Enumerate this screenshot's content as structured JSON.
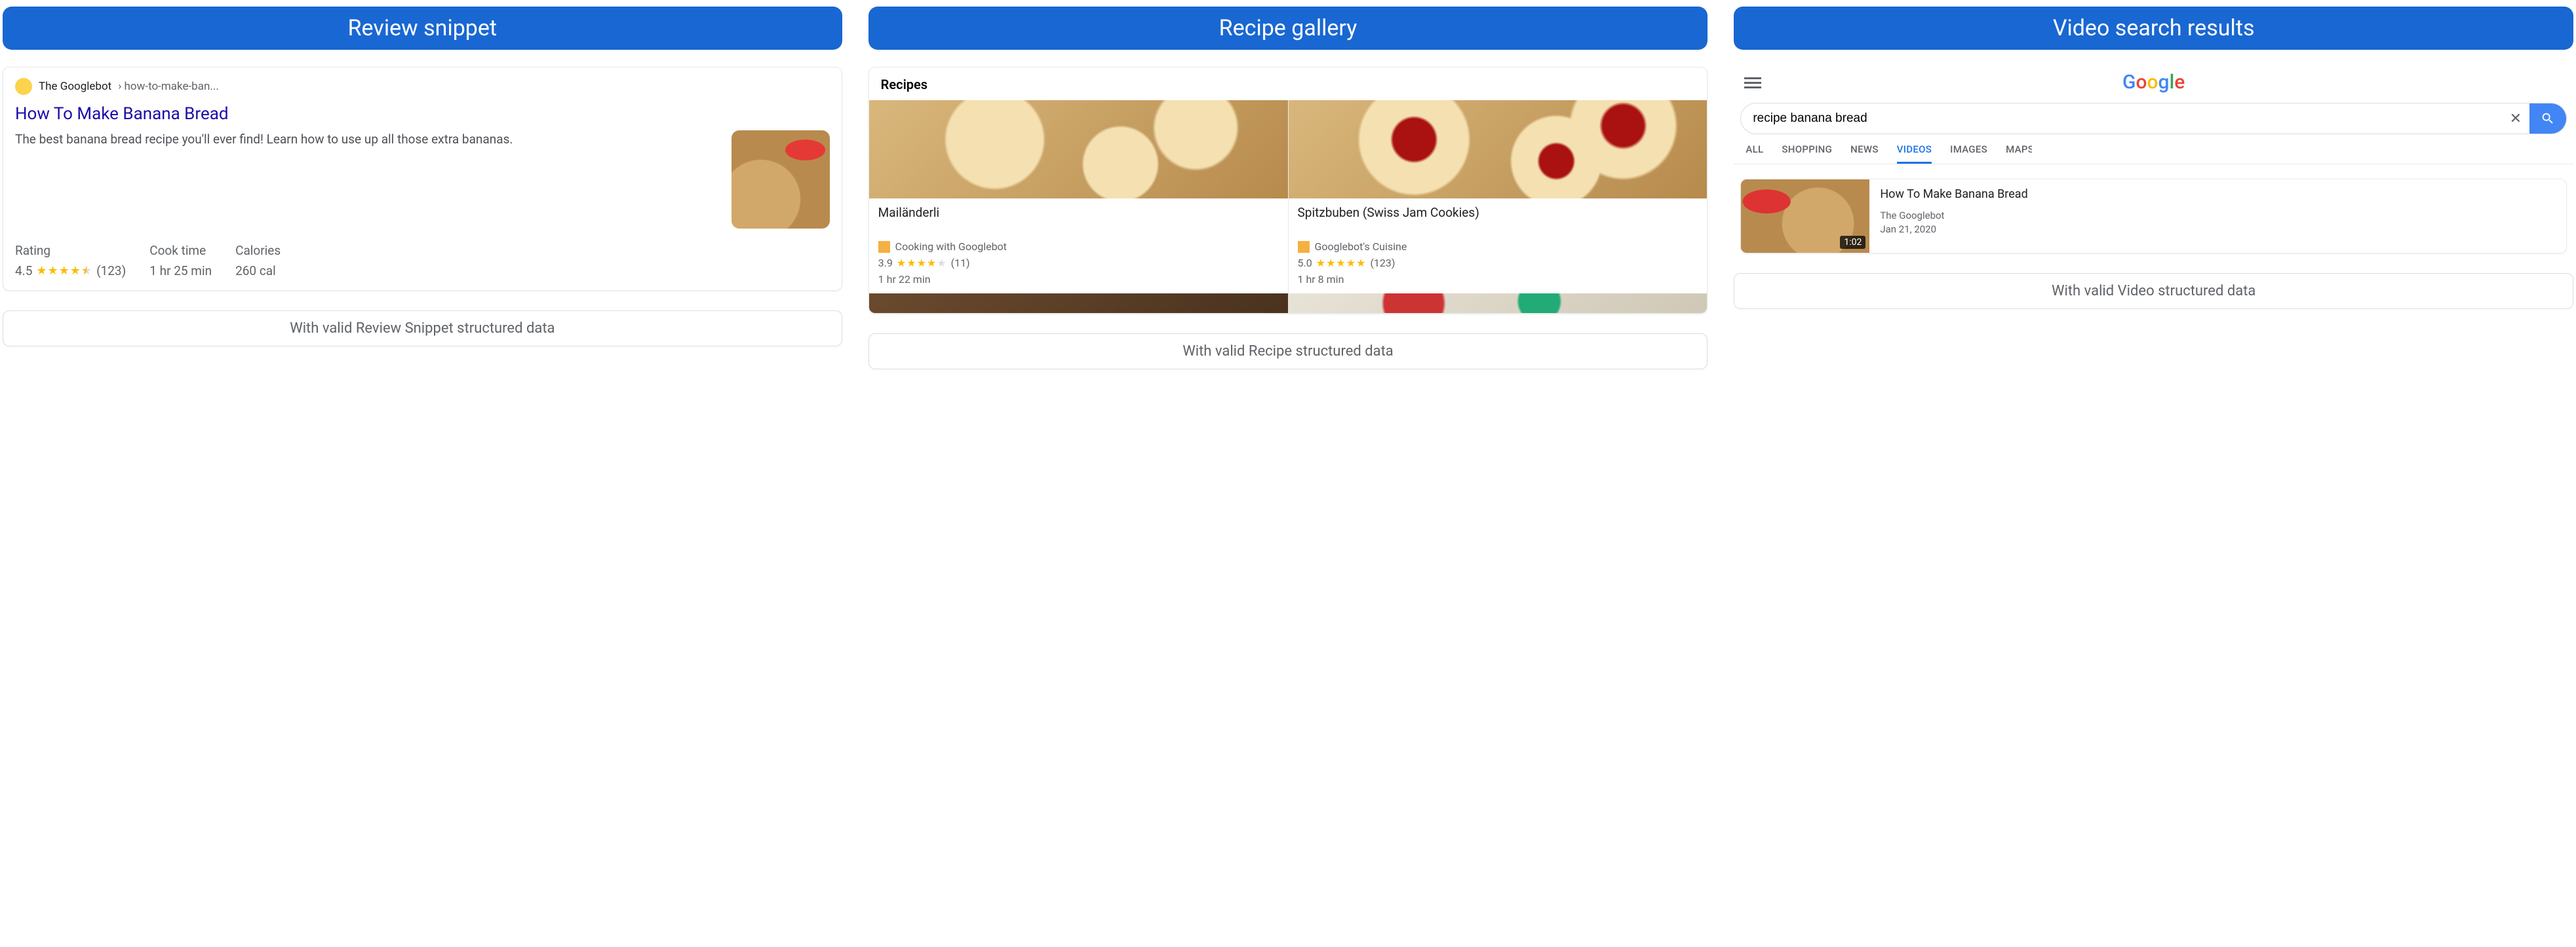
{
  "headers": {
    "review": "Review snippet",
    "gallery": "Recipe gallery",
    "video": "Video search results"
  },
  "captions": {
    "review": "With valid Review Snippet structured data",
    "gallery": "With valid Recipe structured data",
    "video": "With valid Video structured data"
  },
  "review_snippet": {
    "source_name": "The Googlebot",
    "source_path": "› how-to-make-ban...",
    "title": "How To Make Banana Bread",
    "description": "The best banana bread recipe you'll ever find! Learn how to use up all those extra bananas.",
    "rating_label": "Rating",
    "rating_value": "4.5",
    "rating_count": "(123)",
    "cook_label": "Cook time",
    "cook_value": "1 hr 25 min",
    "cal_label": "Calories",
    "cal_value": "260 cal"
  },
  "gallery": {
    "title": "Recipes",
    "items": [
      {
        "name": "Mailänderli",
        "source": "Cooking with Googlebot",
        "rating": "3.9",
        "count": "(11)",
        "time": "1 hr 22 min"
      },
      {
        "name": "Spitzbuben (Swiss Jam Cookies)",
        "source": "Googlebot's Cuisine",
        "rating": "5.0",
        "count": "(123)",
        "time": "1 hr 8 min"
      }
    ]
  },
  "video": {
    "query": "recipe banana bread",
    "tabs": {
      "all": "ALL",
      "shopping": "SHOPPING",
      "news": "NEWS",
      "videos": "VIDEOS",
      "images": "IMAGES",
      "maps": "MAPS"
    },
    "result": {
      "title": "How To Make Banana Bread",
      "source": "The Googlebot",
      "date": "Jan 21, 2020",
      "duration": "1:02"
    }
  }
}
